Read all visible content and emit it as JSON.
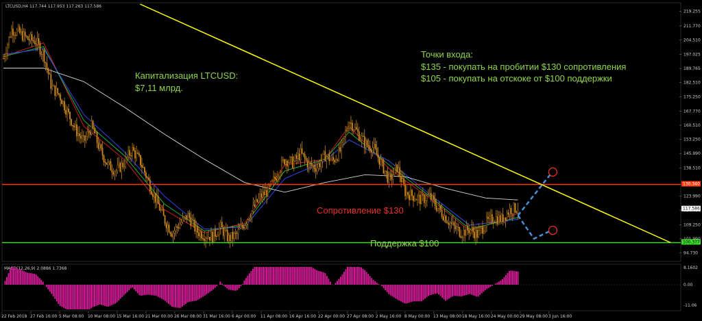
{
  "header": {
    "symbol_info": "LTCUSD,H4  117.744 117.953 117.263 117.586"
  },
  "annotations": {
    "cap_title": "Капитализация LTCUSD:",
    "cap_value": "$7,11 млрд.",
    "entry_title": "Точки входа:",
    "entry_line1": "$135 - покупать на пробитии $130 сопротивления",
    "entry_line2": "$105 - покупать на отскоке от $100 поддержки",
    "resistance": "Сопротивление $130",
    "support": "Поддержка $100"
  },
  "price_tags": {
    "resistance": "130.340",
    "current": "117.586",
    "support": "100.377"
  },
  "macd": {
    "label": "MACD(12,26,9) 2.0886 1.7368"
  },
  "colors": {
    "background": "#000000",
    "candle": "#c8861e",
    "resistance_line": "#ff3a10",
    "support_line": "#3ddc2a",
    "trend_line": "#ffff00",
    "forecast": "#4a90d9",
    "macd_hist": "#d01a94",
    "ma_fast": "#d22",
    "ma_mid": "#20c040",
    "ma_slow": "#3050ff",
    "ma_long": "#d8d8d8"
  },
  "chart_data": {
    "type": "candlestick",
    "symbol": "LTCUSD",
    "timeframe": "H4",
    "x_tick_labels": [
      "22 Feb 2018",
      "27 Feb 16:00",
      "5 Mar 08:00",
      "10 Mar 08:00",
      "15 Mar 16:00",
      "21 Mar 00:00",
      "26 Mar 08:00",
      "31 Mar 16:00",
      "6 Apr 00:00",
      "11 Apr 08:00",
      "16 Apr 16:00",
      "22 Apr 00:00",
      "27 Apr 08:00",
      "2 May 16:00",
      "8 May 00:00",
      "13 May 08:00",
      "18 May 16:00",
      "24 May 00:00",
      "29 May 08:00",
      "3 Jun 16:00"
    ],
    "y_tick_labels": [
      "219.255",
      "211.770",
      "204.510",
      "197.025",
      "189.765",
      "182.510",
      "175.250",
      "167.770",
      "160.510",
      "153.250",
      "145.990",
      "138.510",
      "123.990",
      "116.730",
      "109.250",
      "101.990",
      "94.730"
    ],
    "ylim": [
      91,
      223
    ],
    "close_points": [
      [
        0,
        195
      ],
      [
        1,
        210
      ],
      [
        2,
        208
      ],
      [
        3,
        205
      ],
      [
        4,
        204
      ],
      [
        5,
        197
      ],
      [
        6,
        180
      ],
      [
        7,
        176
      ],
      [
        8,
        167
      ],
      [
        9,
        158
      ],
      [
        10,
        152
      ],
      [
        11,
        160
      ],
      [
        12,
        148
      ],
      [
        13,
        140
      ],
      [
        14,
        137
      ],
      [
        15,
        141
      ],
      [
        16,
        148
      ],
      [
        17,
        142
      ],
      [
        18,
        132
      ],
      [
        19,
        122
      ],
      [
        20,
        112
      ],
      [
        21,
        105
      ],
      [
        22,
        110
      ],
      [
        23,
        114
      ],
      [
        24,
        106
      ],
      [
        25,
        104
      ],
      [
        26,
        103
      ],
      [
        27,
        108
      ],
      [
        28,
        102
      ],
      [
        29,
        104
      ],
      [
        30,
        110
      ],
      [
        31,
        117
      ],
      [
        32,
        124
      ],
      [
        33,
        127
      ],
      [
        34,
        135
      ],
      [
        35,
        143
      ],
      [
        36,
        141
      ],
      [
        37,
        146
      ],
      [
        38,
        140
      ],
      [
        39,
        139
      ],
      [
        40,
        145
      ],
      [
        41,
        142
      ],
      [
        42,
        148
      ],
      [
        43,
        163
      ],
      [
        44,
        157
      ],
      [
        45,
        151
      ],
      [
        46,
        149
      ],
      [
        47,
        141
      ],
      [
        48,
        132
      ],
      [
        49,
        139
      ],
      [
        50,
        126
      ],
      [
        51,
        124
      ],
      [
        52,
        122
      ],
      [
        53,
        124
      ],
      [
        54,
        118
      ],
      [
        55,
        113
      ],
      [
        56,
        108
      ],
      [
        57,
        105
      ],
      [
        58,
        107
      ],
      [
        59,
        104
      ],
      [
        60,
        110
      ],
      [
        61,
        113
      ],
      [
        62,
        112
      ],
      [
        63,
        117
      ],
      [
        64,
        118
      ]
    ],
    "moving_averages": [
      {
        "points": [
          [
            0,
            196
          ],
          [
            5,
            203
          ],
          [
            10,
            160
          ],
          [
            15,
            143
          ],
          [
            20,
            117
          ],
          [
            25,
            105
          ],
          [
            30,
            110
          ],
          [
            35,
            140
          ],
          [
            40,
            143
          ],
          [
            43,
            160
          ],
          [
            48,
            138
          ],
          [
            53,
            123
          ],
          [
            58,
            106
          ],
          [
            64,
            115
          ]
        ]
      },
      {
        "points": [
          [
            0,
            196
          ],
          [
            5,
            201
          ],
          [
            10,
            163
          ],
          [
            15,
            145
          ],
          [
            20,
            120
          ],
          [
            25,
            106
          ],
          [
            30,
            109
          ],
          [
            35,
            137
          ],
          [
            40,
            143
          ],
          [
            43,
            157
          ],
          [
            48,
            140
          ],
          [
            53,
            124
          ],
          [
            58,
            107
          ],
          [
            64,
            113
          ]
        ]
      },
      {
        "points": [
          [
            0,
            197
          ],
          [
            5,
            200
          ],
          [
            10,
            166
          ],
          [
            15,
            147
          ],
          [
            20,
            124
          ],
          [
            25,
            107
          ],
          [
            30,
            108
          ],
          [
            35,
            133
          ],
          [
            40,
            142
          ],
          [
            43,
            153
          ],
          [
            48,
            142
          ],
          [
            53,
            125
          ],
          [
            58,
            109
          ],
          [
            64,
            112
          ]
        ]
      },
      {
        "points": [
          [
            0,
            190
          ],
          [
            5,
            190
          ],
          [
            10,
            183
          ],
          [
            15,
            170
          ],
          [
            20,
            156
          ],
          [
            25,
            143
          ],
          [
            30,
            131
          ],
          [
            35,
            126
          ],
          [
            40,
            131
          ],
          [
            45,
            135
          ],
          [
            50,
            134
          ],
          [
            55,
            128
          ],
          [
            60,
            123
          ],
          [
            64,
            122
          ]
        ]
      }
    ],
    "resistance": 130,
    "support": 100,
    "trend_line": {
      "from": [
        17,
        223
      ],
      "to": [
        83,
        100
      ]
    },
    "forecast_up": [
      [
        64,
        114
      ],
      [
        68,
        135
      ]
    ],
    "forecast_down": [
      [
        64,
        114
      ],
      [
        66,
        102
      ],
      [
        68,
        106
      ]
    ],
    "macd_histogram_range": [
      -22,
      8.16
    ]
  }
}
